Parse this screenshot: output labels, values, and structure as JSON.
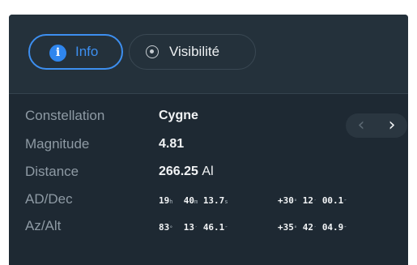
{
  "tabs": {
    "info": {
      "label": "Info",
      "icon": "info-icon",
      "active": true
    },
    "visibility": {
      "label": "Visibilité",
      "icon": "visibility-icon",
      "active": false
    }
  },
  "nav": {
    "prev_icon": "chevron-left-icon",
    "next_icon": "chevron-right-icon",
    "prev_glyph": "‹",
    "next_glyph": "›"
  },
  "details": {
    "constellation": {
      "label": "Constellation",
      "value": "Cygne"
    },
    "magnitude": {
      "label": "Magnitude",
      "value": "4.81"
    },
    "distance": {
      "label": "Distance",
      "value": "266.25",
      "unit": "Al"
    },
    "ad_dec": {
      "label": "AD/Dec",
      "ra": {
        "h": "19",
        "h_unit": "h",
        "m": "40",
        "m_unit": "m",
        "s": "13.7",
        "s_unit": "s"
      },
      "dec": {
        "deg": "+30",
        "deg_unit": "°",
        "min": "12",
        "min_unit": "′",
        "sec": "00.1",
        "sec_unit": "″"
      }
    },
    "az_alt": {
      "label": "Az/Alt",
      "az": {
        "deg": "83",
        "deg_unit": "°",
        "min": "13",
        "min_unit": "′",
        "sec": "46.1",
        "sec_unit": "″"
      },
      "alt": {
        "deg": "+35",
        "deg_unit": "°",
        "min": "42",
        "min_unit": "′",
        "sec": "04.9",
        "sec_unit": "″"
      }
    }
  },
  "colors": {
    "accent": "#3d8ff0",
    "panel_bg": "#1e2933",
    "header_bg": "#24313b",
    "label_text": "#8e9aa4",
    "value_text": "#f2f4f6"
  }
}
